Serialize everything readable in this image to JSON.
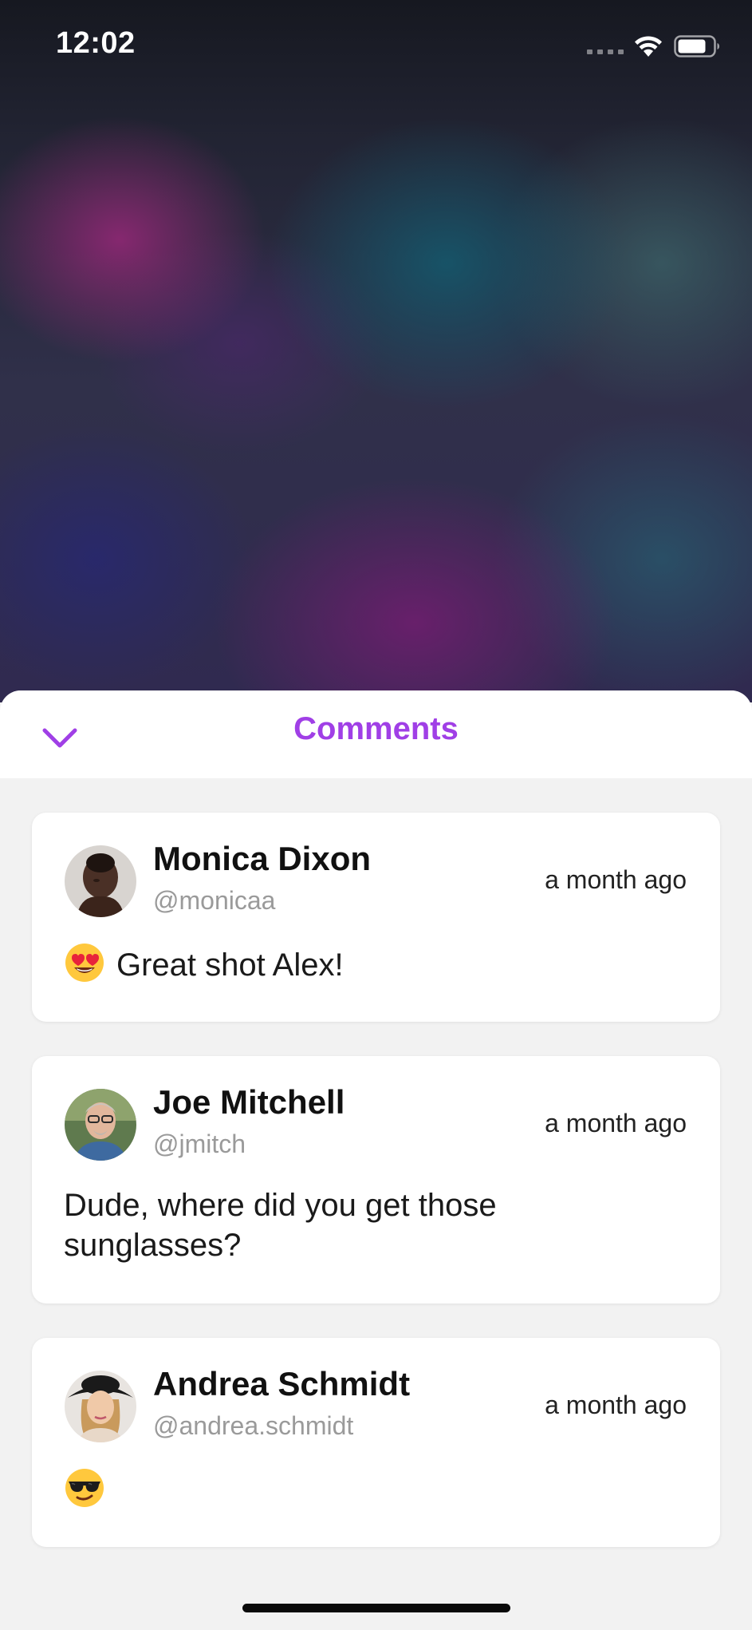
{
  "status_bar": {
    "time": "12:02"
  },
  "sheet": {
    "title": "Comments",
    "collapse_icon": "chevron-down-icon",
    "accent_color": "#a03fe6"
  },
  "comments": [
    {
      "name": "Monica Dixon",
      "handle": "@monicaa",
      "time": "a month ago",
      "emoji": "heart-eyes-emoji",
      "text": "Great shot Alex!"
    },
    {
      "name": "Joe Mitchell",
      "handle": "@jmitch",
      "time": "a month ago",
      "text": "Dude, where did you get those sunglasses?"
    },
    {
      "name": "Andrea Schmidt",
      "handle": "@andrea.schmidt",
      "time": "a month ago",
      "emoji": "sunglasses-emoji",
      "text": ""
    }
  ]
}
